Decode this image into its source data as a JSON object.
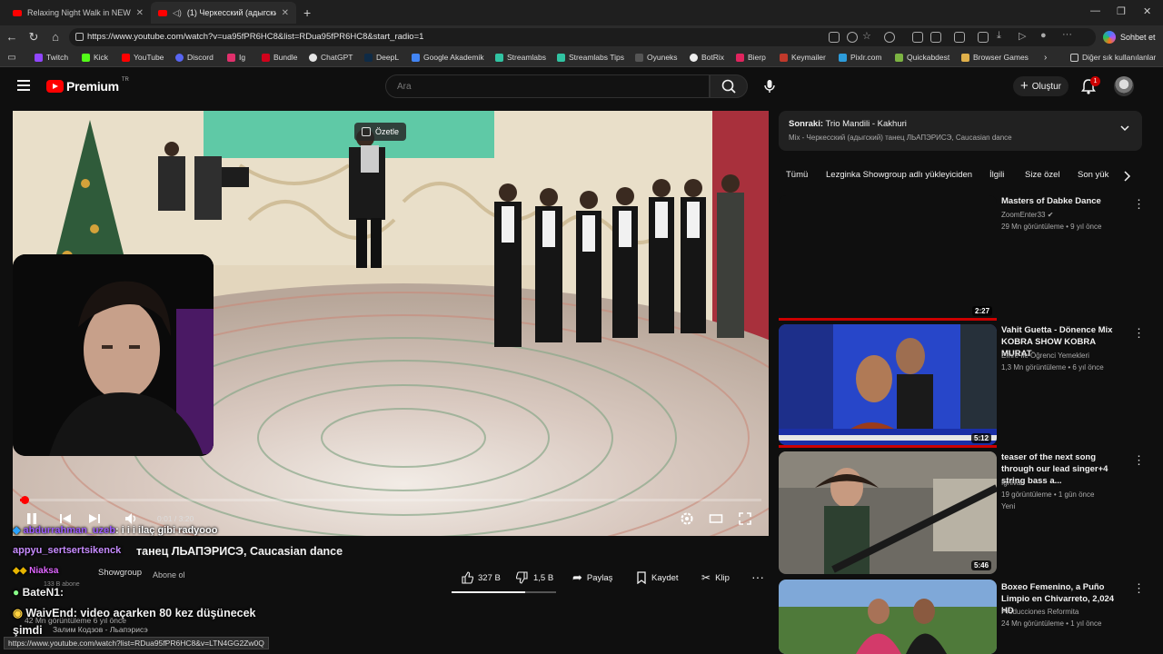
{
  "browser": {
    "tabs": [
      {
        "title": "Relaxing Night Walk in NEW YORK",
        "active": false
      },
      {
        "title": "(1) Черкесский (адыгский) та...",
        "active": true
      }
    ],
    "url": "https://www.youtube.com/watch?v=ua95fPR6HC8&list=RDua95fPR6HC8&start_radio=1",
    "copilot_label": "Sohbet et",
    "bookmarks": [
      "Twitch",
      "Kick",
      "YouTube",
      "Discord",
      "Ig",
      "Bundle",
      "ChatGPT",
      "DeepL",
      "Google Akademik",
      "Streamlabs",
      "Streamlabs Tips",
      "Oyuneks",
      "BotRix",
      "Bierp",
      "Keymailer",
      "Pixlr.com",
      "Quickabdest",
      "Browser Games"
    ],
    "bookmarks_overflow_label": "Diğer sık kullanılanlar",
    "status_url": "https://www.youtube.com/watch?list=RDua95fPR6HC8&v=LTN4GG2Zw0Q"
  },
  "youtube": {
    "logo_word": "Premium",
    "logo_region": "TR",
    "search_placeholder": "Ara",
    "create_label": "Oluştur",
    "notification_count": "1"
  },
  "player": {
    "summarize_label": "Özetle",
    "time_current": "0:01",
    "time_total": "3:20",
    "progress_fraction": 0.005
  },
  "chat": [
    {
      "user": "abdurrahman_uzeb",
      "text": ": i i i ilaç gibi radyooo",
      "color": "#9b59ff"
    },
    {
      "user": "appyu_sertsertsikenck",
      "text": "",
      "color": "#c78bff"
    },
    {
      "user": "Niaksa",
      "text": "",
      "color": "#e066ff"
    },
    {
      "user": "BateN1",
      "text": ":",
      "color": "#ffffff"
    },
    {
      "user": "WaivEnd",
      "text": ": video açarken 80 kez düşünecek",
      "color": "#ffffff"
    },
    {
      "user": "",
      "text": "şimdi",
      "color": "#ffffff"
    }
  ],
  "video": {
    "title_visible": "танец ЛЬАПЭРИСЭ, Caucasian dance",
    "channel_visible": "Showgroup",
    "subscribers_visible": "133 B abone",
    "subscribe_label": "Abone ol",
    "likes": "327 B",
    "dislikes": "1,5 B",
    "share_label": "Paylaş",
    "save_label": "Kaydet",
    "clip_label": "Klip",
    "like_ratio": 0.7,
    "desc_meta_visible": "42 Mn görüntüleme  6 yıl önce",
    "desc_text_visible": "Залим Кодзов - Льапэрисэ"
  },
  "sidebar": {
    "next_label": "Sonraki:",
    "next_song": "Trio Mandili - Kakhuri",
    "mix_title": "Mix - Черкесский (адыгский) танец ЛЬАПЭРИСЭ, Caucasian dance",
    "chips": [
      "Tümü",
      "Lezginka Showgroup adlı yükleyiciden",
      "İlgili",
      "Size özel",
      "Son yük"
    ],
    "recs": [
      {
        "title": "Masters of Dabke Dance",
        "channel": "ZoomEnter33",
        "verified": true,
        "meta": "29 Mn görüntüleme • 9 yıl önce",
        "duration": "2:27",
        "badge": ""
      },
      {
        "title": "Vahit Guetta - Dönence Mix KOBRA SHOW KOBRA MURAT",
        "channel": "Emre İle Öğrenci Yemekleri",
        "verified": false,
        "meta": "1,3 Mn görüntüleme • 6 yıl önce",
        "duration": "5:12",
        "badge": ""
      },
      {
        "title": "teaser of the next song through our lead singer+4 string bass a...",
        "channel": "Ignivar",
        "verified": false,
        "meta": "19 görüntüleme • 1 gün önce",
        "duration": "5:46",
        "badge": "Yeni"
      },
      {
        "title": "Boxeo Femenino, a Puño Limpio en Chivarreto, 2,024 HD",
        "channel": "Producciones Reformita",
        "verified": false,
        "meta": "24 Mn görüntüleme • 1 yıl önce",
        "duration": "",
        "badge": ""
      }
    ]
  },
  "colors": {
    "accent": "#ff0000",
    "bg": "#0f0f0f",
    "card": "#212121"
  }
}
